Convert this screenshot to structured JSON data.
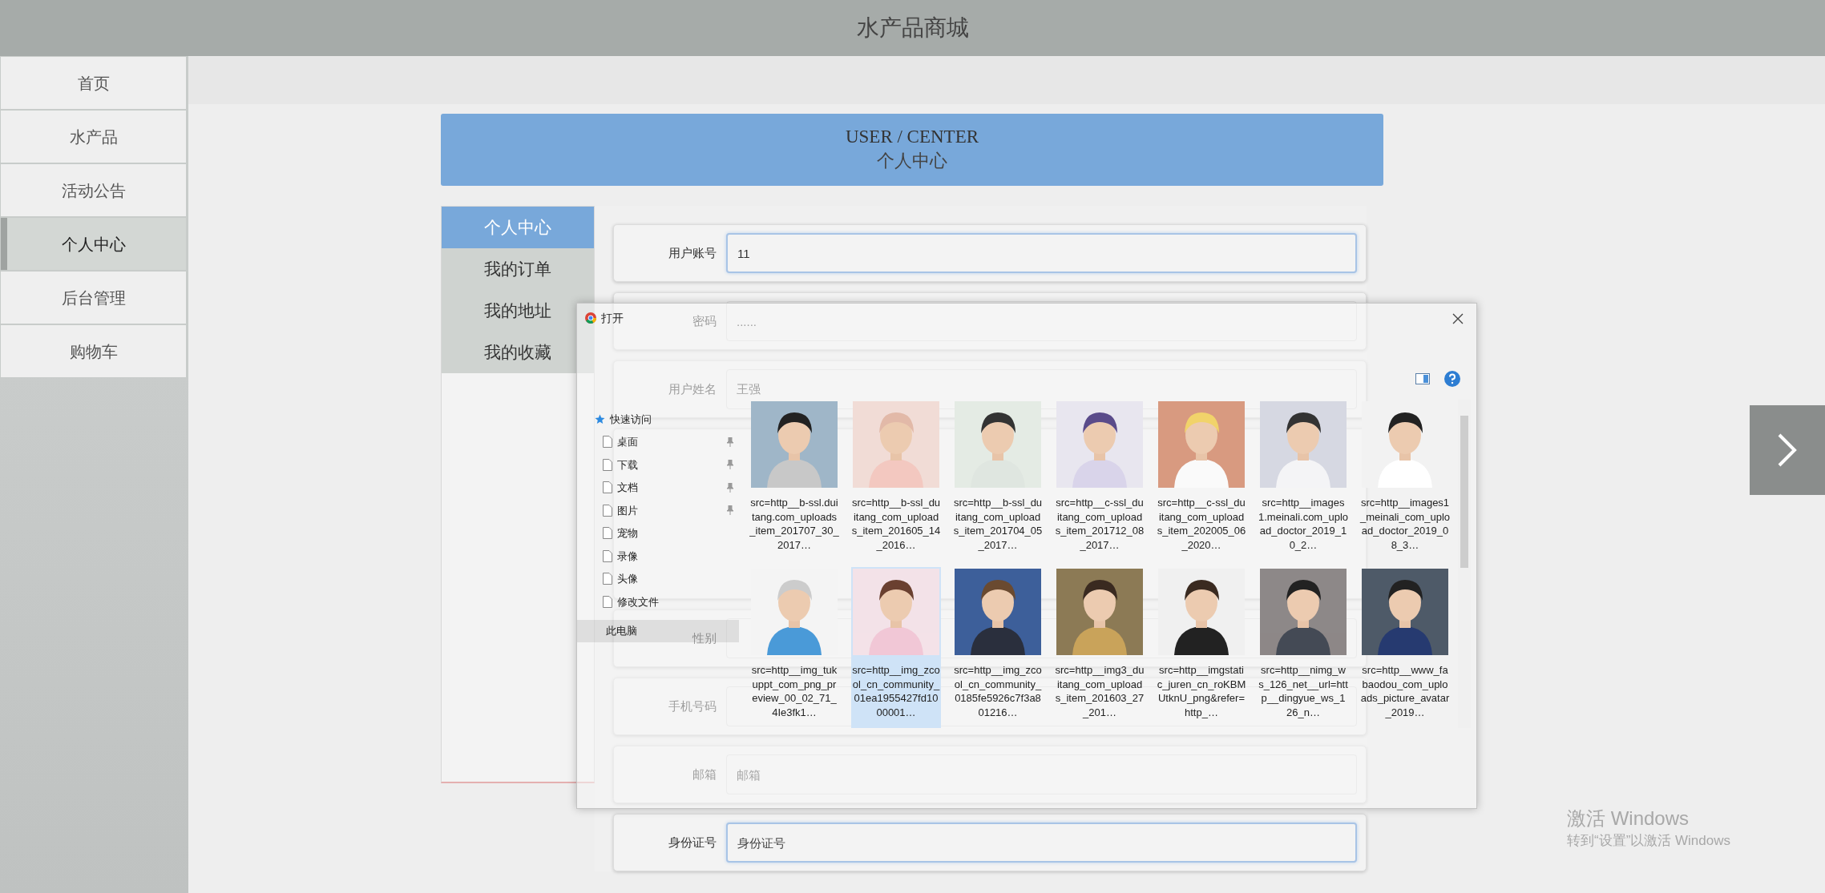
{
  "header": {
    "title": "水产品商城"
  },
  "nav": [
    {
      "label": "首页",
      "selected": false
    },
    {
      "label": "水产品",
      "selected": false
    },
    {
      "label": "活动公告",
      "selected": false
    },
    {
      "label": "个人中心",
      "selected": true
    },
    {
      "label": "后台管理",
      "selected": false
    },
    {
      "label": "购物车",
      "selected": false
    }
  ],
  "banner": {
    "title": "USER / CENTER",
    "subtitle": "个人中心"
  },
  "tabs": [
    {
      "label": "个人中心",
      "selected": true
    },
    {
      "label": "我的订单",
      "selected": false
    },
    {
      "label": "我的地址",
      "selected": false
    },
    {
      "label": "我的收藏",
      "selected": false
    }
  ],
  "form": [
    {
      "kind": "field",
      "label": "用户账号",
      "value": "11",
      "focused": true
    },
    {
      "kind": "field",
      "label": "密码",
      "value": "......"
    },
    {
      "kind": "field",
      "label": "用户姓名",
      "value": "王强"
    },
    {
      "kind": "upload"
    },
    {
      "kind": "field",
      "label": "性别"
    },
    {
      "kind": "field",
      "label": "手机号码"
    },
    {
      "kind": "field",
      "label": "邮箱",
      "placeholder": "邮箱"
    },
    {
      "kind": "field",
      "label": "身份证号",
      "placeholder": "身份证号",
      "focused": true
    }
  ],
  "dialog": {
    "title": "打开",
    "tree": [
      {
        "label": "快速访问",
        "selected": false,
        "children": [
          {
            "label": "桌面",
            "pinned": true,
            "selected": false
          },
          {
            "label": "下载",
            "pinned": true,
            "selected": false
          },
          {
            "label": "文档",
            "pinned": true,
            "selected": false
          },
          {
            "label": "图片",
            "pinned": true,
            "selected": false
          },
          {
            "label": "宠物",
            "pinned": false,
            "selected": false
          },
          {
            "label": "录像",
            "pinned": false,
            "selected": false
          },
          {
            "label": "头像",
            "pinned": false,
            "selected": false
          },
          {
            "label": "修改文件",
            "pinned": false,
            "selected": false
          }
        ]
      },
      {
        "label": "此电脑",
        "selected": true
      }
    ],
    "files": [
      {
        "name": "src=http__b-ssl.duitang.com_uploads_item_201707_30_2017…",
        "selected": false
      },
      {
        "name": "src=http__b-ssl_duitang_com_uploads_item_201605_14_2016…",
        "selected": false
      },
      {
        "name": "src=http__b-ssl_duitang_com_uploads_item_201704_05_2017…",
        "selected": false
      },
      {
        "name": "src=http__c-ssl_duitang_com_uploads_item_201712_08_2017…",
        "selected": false
      },
      {
        "name": "src=http__c-ssl_duitang_com_uploads_item_202005_06_2020…",
        "selected": false
      },
      {
        "name": "src=http__images1.meinali.com_upload_doctor_2019_10_2…",
        "selected": false
      },
      {
        "name": "src=http__images1_meinali_com_upload_doctor_2019_08_3…",
        "selected": false
      },
      {
        "name": "src=http__img_tukuppt_com_png_preview_00_02_71_4Ie3fk1…",
        "selected": false
      },
      {
        "name": "src=http__img_zcool_cn_community_01ea1955427fd1000001…",
        "selected": true
      },
      {
        "name": "src=http__img_zcool_cn_community_0185fe5926c7f3a801216…",
        "selected": false
      },
      {
        "name": "src=http__img3_duitang_com_uploads_item_201603_27_201…",
        "selected": false
      },
      {
        "name": "src=http__imgstatic_juren_cn_roKBMUtknU_png&refer=http_…",
        "selected": false
      },
      {
        "name": "src=http__nimg_ws_126_net__url=http__dingyue_ws_126_n…",
        "selected": false
      },
      {
        "name": "src=http__www_fabaodou_com_uploads_picture_avatar_2019…",
        "selected": false
      }
    ]
  },
  "activation": {
    "title": "激活 Windows",
    "subtitle": "转到“设置”以激活 Windows"
  }
}
